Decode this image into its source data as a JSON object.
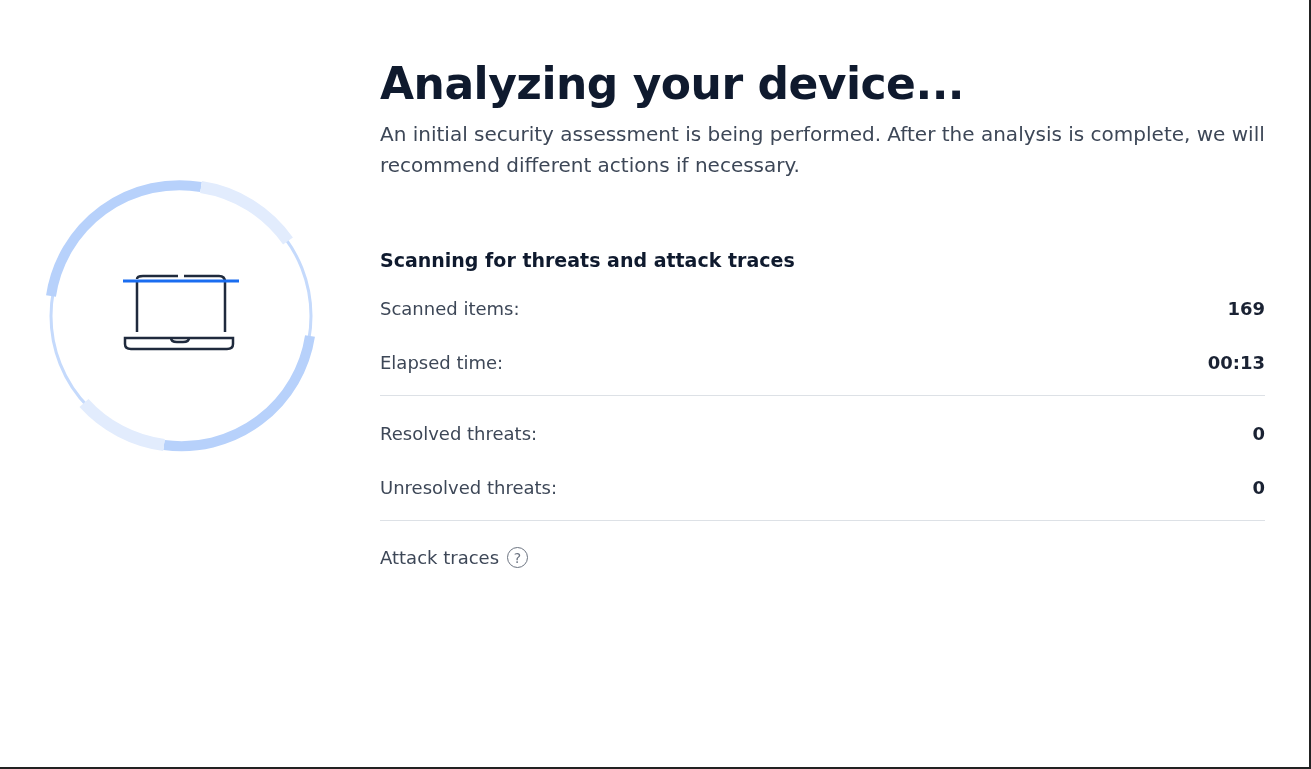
{
  "title": "Analyzing your device...",
  "description": "An initial security assessment is being performed. After the analysis is complete, we will recommend different actions if necessary.",
  "scan": {
    "heading": "Scanning for threats and attack traces",
    "groups": [
      [
        {
          "label": "Scanned items:",
          "value": "169"
        },
        {
          "label": "Elapsed time:",
          "value": "00:13"
        }
      ],
      [
        {
          "label": "Resolved threats:",
          "value": "0"
        },
        {
          "label": "Unresolved threats:",
          "value": "0"
        }
      ]
    ],
    "attack_traces": {
      "label": "Attack traces",
      "help": "?"
    }
  }
}
